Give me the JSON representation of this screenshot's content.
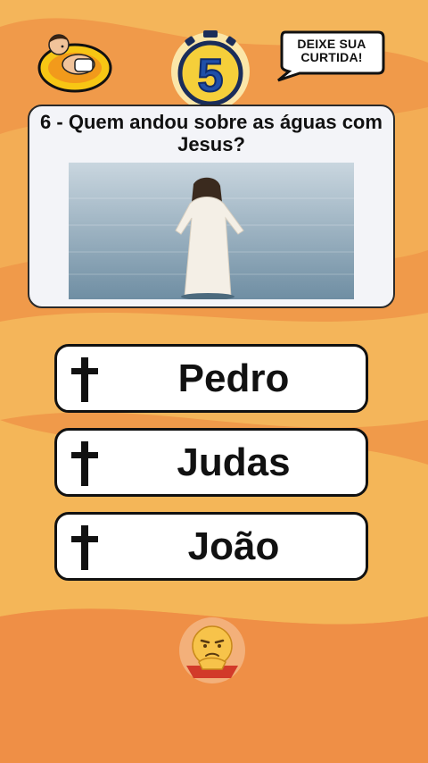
{
  "timer": {
    "count": "5"
  },
  "bubble": {
    "line1": "DEIXE SUA",
    "line2": "CURTIDA!"
  },
  "question": {
    "text": "6 - Quem andou sobre as águas com Jesus?"
  },
  "answers": [
    {
      "label": "Pedro",
      "icon": "cross-icon"
    },
    {
      "label": "Judas",
      "icon": "cross-icon"
    },
    {
      "label": "João",
      "icon": "cross-icon"
    }
  ],
  "colors": {
    "background_light": "#f4b858",
    "background_dark": "#ef8f46",
    "timer_yellow": "#f5cf3a",
    "timer_blue": "#1f4fa8",
    "card_bg": "#f3f4f8"
  }
}
